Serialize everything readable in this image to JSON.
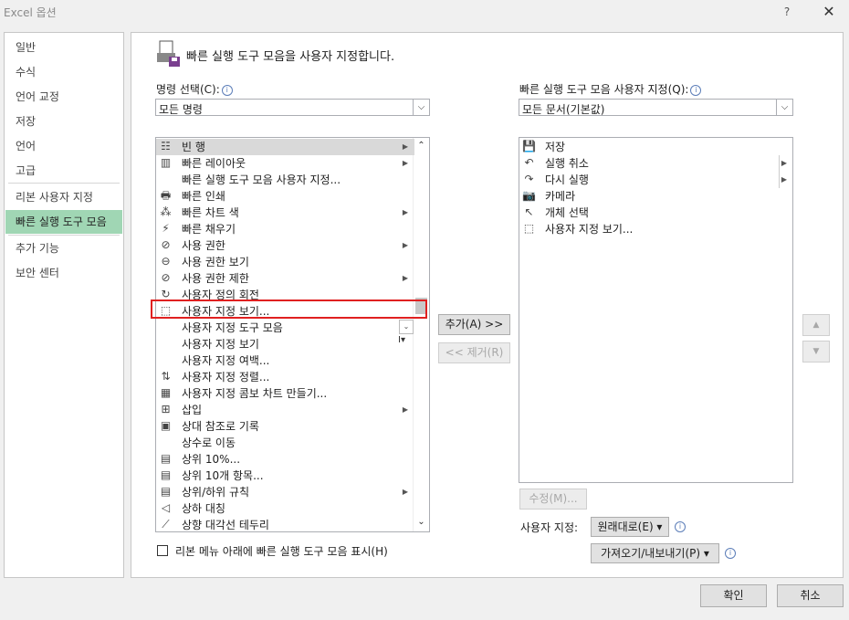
{
  "window": {
    "title": "Excel 옵션",
    "help_label": "?",
    "close_label": "✕"
  },
  "sidebar": {
    "items": [
      {
        "label": "일반"
      },
      {
        "label": "수식"
      },
      {
        "label": "언어 교정"
      },
      {
        "label": "저장"
      },
      {
        "label": "언어"
      },
      {
        "label": "고급"
      },
      {
        "label": "리본 사용자 지정"
      },
      {
        "label": "빠른 실행 도구 모음"
      },
      {
        "label": "추가 기능"
      },
      {
        "label": "보안 센터"
      }
    ]
  },
  "header": {
    "title": "빠른 실행 도구 모음을 사용자 지정합니다."
  },
  "left": {
    "label": "명령 선택(C):",
    "combo_value": "모든 명령",
    "commands": [
      {
        "icon": "☷",
        "label": "빈 행",
        "submenu": true
      },
      {
        "icon": "▥",
        "label": "빠른 레이아웃",
        "submenu": true
      },
      {
        "icon": "",
        "label": "빠른 실행 도구 모음 사용자 지정...",
        "submenu": false
      },
      {
        "icon": "🖶",
        "label": "빠른 인쇄",
        "submenu": false
      },
      {
        "icon": "⁂",
        "label": "빠른 차트 색",
        "submenu": true
      },
      {
        "icon": "⚡",
        "label": "빠른 채우기",
        "submenu": false
      },
      {
        "icon": "⊘",
        "label": "사용 권한",
        "submenu": true
      },
      {
        "icon": "⊖",
        "label": "사용 권한 보기",
        "submenu": false
      },
      {
        "icon": "⊘",
        "label": "사용 권한 제한",
        "submenu": true
      },
      {
        "icon": "↻",
        "label": "사용자 정의 회전",
        "submenu": false
      },
      {
        "icon": "⬚",
        "label": "사용자 지정 보기...",
        "submenu": false
      },
      {
        "icon": "",
        "label": "사용자 지정 도구 모음",
        "submenu": false
      },
      {
        "icon": "",
        "label": "사용자 지정 보기",
        "submenu": false
      },
      {
        "icon": "",
        "label": "사용자 지정 여백...",
        "submenu": false
      },
      {
        "icon": "⇅",
        "label": "사용자 지정 정렬...",
        "submenu": false
      },
      {
        "icon": "▦",
        "label": "사용자 지정 콤보 차트 만들기...",
        "submenu": false
      },
      {
        "icon": "⊞",
        "label": "삽입",
        "submenu": true
      },
      {
        "icon": "▣",
        "label": "상대 참조로 기록",
        "submenu": false
      },
      {
        "icon": "",
        "label": "상수로 이동",
        "submenu": false
      },
      {
        "icon": "▤",
        "label": "상위 10%...",
        "submenu": false
      },
      {
        "icon": "▤",
        "label": "상위 10개 항목...",
        "submenu": false
      },
      {
        "icon": "▤",
        "label": "상위/하위 규칙",
        "submenu": true
      },
      {
        "icon": "◁",
        "label": "상하 대칭",
        "submenu": false
      },
      {
        "icon": "⟋",
        "label": "상향 대각선 테두리",
        "submenu": false
      }
    ]
  },
  "right": {
    "label": "빠른 실행 도구 모음 사용자 지정(Q):",
    "combo_value": "모든 문서(기본값)",
    "items": [
      {
        "icon": "💾",
        "label": "저장",
        "submenu": false
      },
      {
        "icon": "↶",
        "label": "실행 취소",
        "submenu": true
      },
      {
        "icon": "↷",
        "label": "다시 실행",
        "submenu": true
      },
      {
        "icon": "📷",
        "label": "카메라",
        "submenu": false
      },
      {
        "icon": "↖",
        "label": "개체 선택",
        "submenu": false
      },
      {
        "icon": "⬚",
        "label": "사용자 지정 보기...",
        "submenu": false
      }
    ]
  },
  "buttons": {
    "add": "추가(A) >>",
    "remove": "<< 제거(R)",
    "up": "▲",
    "down": "▼",
    "modify": "수정(M)...",
    "custom_label": "사용자 지정:",
    "reset": "원래대로(E) ▾",
    "import_export": "가져오기/내보내기(P) ▾",
    "ok": "확인",
    "cancel": "취소"
  },
  "checkbox": {
    "label": "리본 메뉴 아래에 빠른 실행 도구 모음 표시(H)",
    "checked": false
  },
  "colors": {
    "active_sidebar": "#a0d6b4",
    "highlight": "#e02020"
  }
}
